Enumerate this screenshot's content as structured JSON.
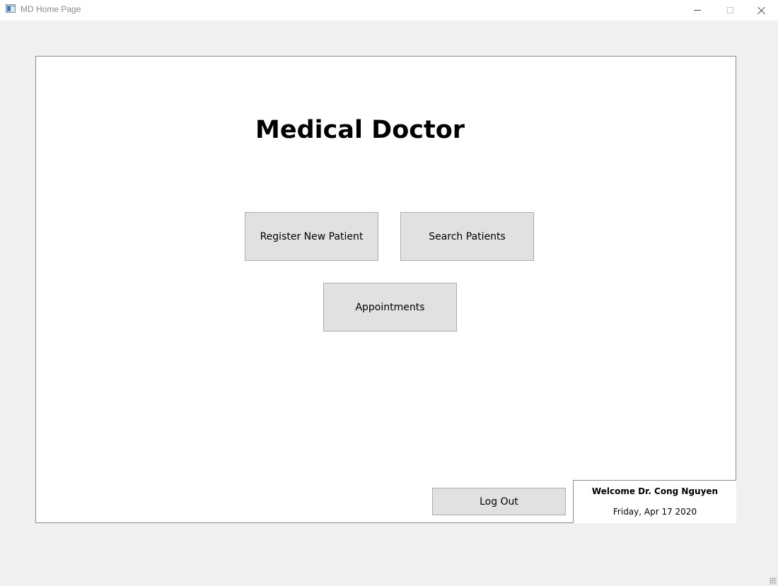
{
  "window": {
    "title": "MD Home Page",
    "icons": {
      "app": "app-window-icon",
      "minimize": "minimize-icon",
      "maximize": "maximize-icon",
      "close": "close-icon"
    }
  },
  "main": {
    "title": "Medical Doctor",
    "buttons": {
      "register": "Register New Patient",
      "search": "Search Patients",
      "appointments": "Appointments",
      "logout": "Log Out"
    }
  },
  "status": {
    "welcome": "Welcome Dr. Cong Nguyen",
    "date": "Friday, Apr 17 2020"
  },
  "colors": {
    "button_bg": "#e1e1e1",
    "panel_bg": "#ffffff",
    "window_bg": "#f0f0f0"
  }
}
